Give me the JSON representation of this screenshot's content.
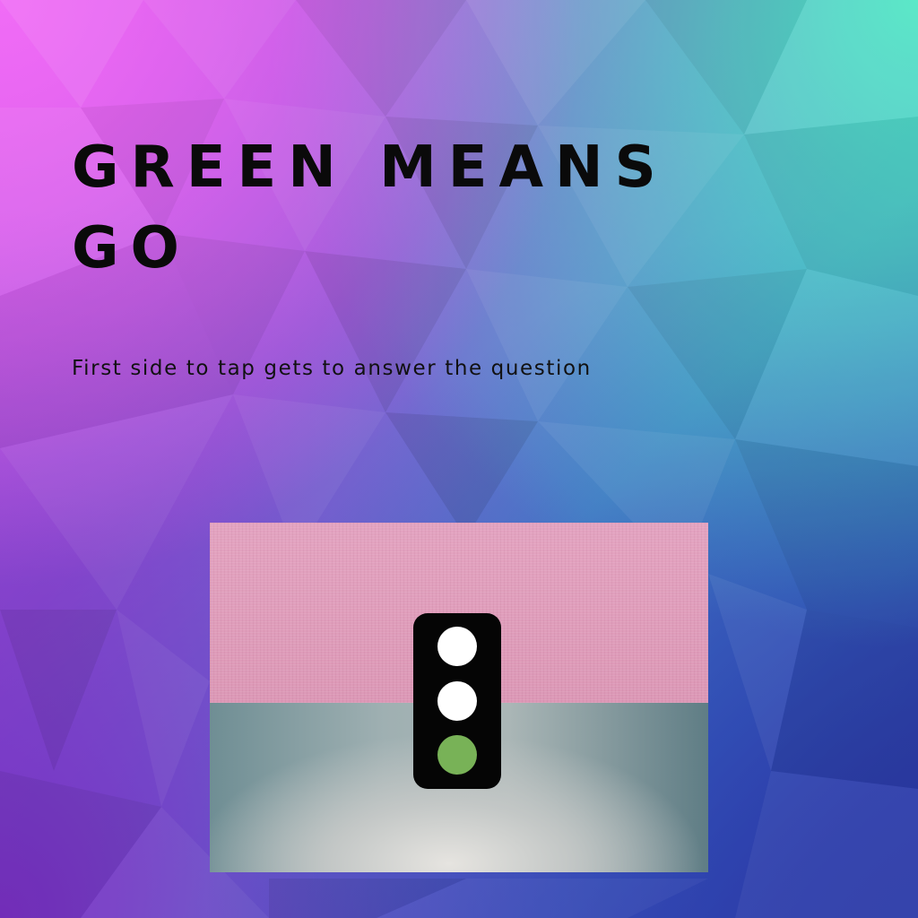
{
  "slide": {
    "title": "GREEN MEANS GO",
    "subtitle": "First side to tap gets to answer the question"
  },
  "illustration": {
    "icon": "traffic-light-icon",
    "lamps": [
      {
        "state": "off",
        "color": "#ffffff"
      },
      {
        "state": "off",
        "color": "#ffffff"
      },
      {
        "state": "on",
        "color": "#78b257"
      }
    ]
  },
  "colors": {
    "title_text": "#0a0a0a",
    "fabric": "#e3a3c0",
    "traffic_light_body": "#050505",
    "green_lamp": "#78b257"
  }
}
